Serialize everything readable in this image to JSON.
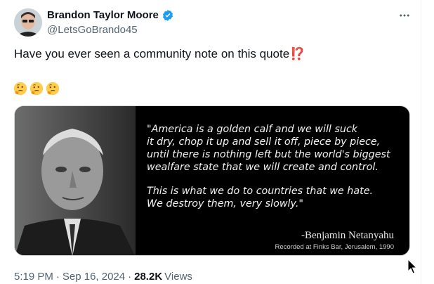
{
  "author": {
    "name": "Brandon Taylor Moore",
    "handle": "@LetsGoBrando45",
    "verified": true,
    "avatar_icon": "avatar-photo"
  },
  "tweet": {
    "text": "Have you ever seen a community note on this quote",
    "text_emoji": "⁉️",
    "emoji_line": [
      "🤔",
      "🤔",
      "🤔"
    ]
  },
  "media": {
    "quote_part1": "\"America is a golden calf and we will suck\nit dry, chop it up and sell it off, piece by piece,\nuntil there is nothing left but the world's biggest\nwealfare state that we will create and control.",
    "quote_part2": "This is what we do to countries that we hate.\nWe destroy them, very slowly.\"",
    "attribution": "-Benjamin Netanyahu",
    "recorded": "Recorded at Finks Bar, Jerusalem, 1990"
  },
  "meta": {
    "time": "5:19 PM",
    "date": "Sep 16, 2024",
    "views_count": "28.2K",
    "views_label": "Views"
  },
  "colors": {
    "verified": "#1d9bf0",
    "secondary_text": "#536471",
    "primary_text": "#0f1419"
  }
}
